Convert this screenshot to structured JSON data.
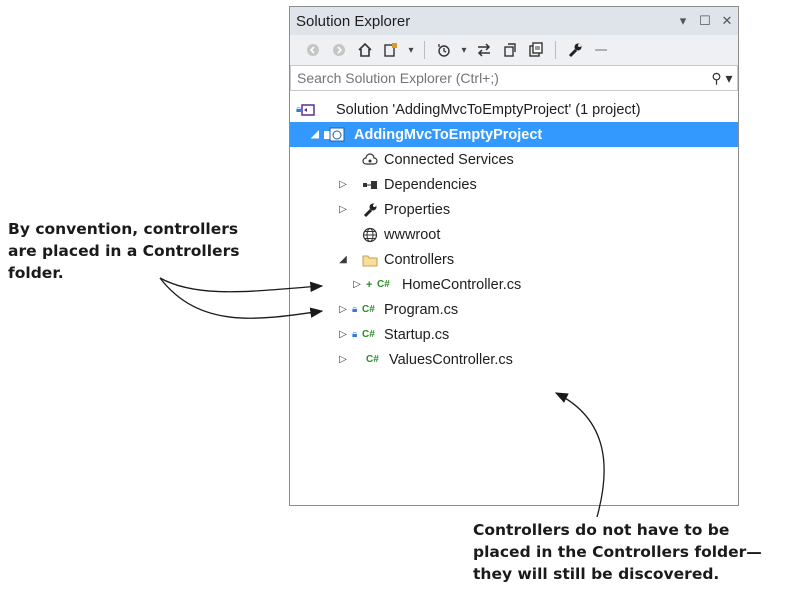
{
  "panel": {
    "title": "Solution Explorer",
    "controls": [
      "▾",
      "☐",
      "✕"
    ],
    "search_placeholder": "Search Solution Explorer (Ctrl+;)"
  },
  "toolbar": {
    "icons": [
      "back-icon",
      "forward-icon",
      "home-icon",
      "switch-views-icon",
      "dropdown-icon",
      "pending-changes-icon",
      "dropdown-icon",
      "sync-icon",
      "collapse-all-icon",
      "show-all-files-icon",
      "properties-wrench-icon",
      "preview-icon"
    ]
  },
  "tree": {
    "solution": "Solution 'AddingMvcToEmptyProject' (1 project)",
    "project": "AddingMvcToEmptyProject",
    "connected_services": "Connected Services",
    "dependencies": "Dependencies",
    "properties": "Properties",
    "wwwroot": "wwwroot",
    "controllers": "Controllers",
    "home_controller": "HomeController.cs",
    "program": "Program.cs",
    "startup": "Startup.cs",
    "values_controller": "ValuesController.cs",
    "cs_badge": "C#"
  },
  "annotations": {
    "left": {
      "line1": "By convention, controllers",
      "line2": "are placed in a  Controllers",
      "line3": "folder."
    },
    "bottom": {
      "line1": "Controllers do not have to be",
      "line2": "placed in the Controllers folder—",
      "line3": "they will still be discovered."
    }
  },
  "colors": {
    "selection": "#3399ff",
    "csharp_badge": "#2b8a2b",
    "lock_badge": "#2f7bd9",
    "titlebar": "#dfe3ea"
  }
}
